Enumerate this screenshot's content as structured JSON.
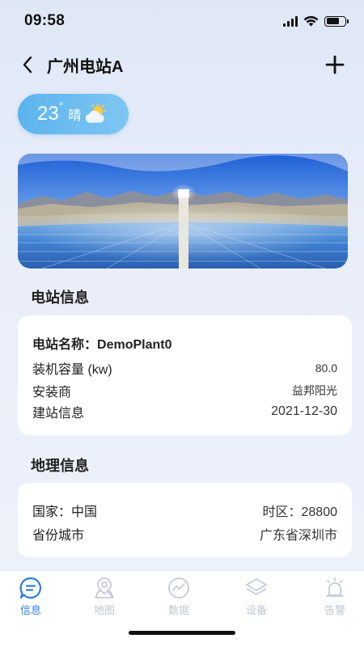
{
  "status_bar": {
    "time": "09:58"
  },
  "nav": {
    "title": "广州电站A"
  },
  "weather": {
    "temperature": "23",
    "degree": "°",
    "condition": "晴",
    "icon": "partly-sunny-icon"
  },
  "station_section": {
    "title": "电站信息",
    "name_label": "电站名称：",
    "name_value": "DemoPlant0",
    "capacity_label": "装机容量 (kw)",
    "capacity_value": "80.0",
    "installer_label": "安装商",
    "installer_value": "益邦阳光",
    "built_label": "建站信息",
    "built_value": "2021-12-30"
  },
  "geo_section": {
    "title": "地理信息",
    "country_label": "国家：",
    "country_value": "中国",
    "timezone_label": "时区：",
    "timezone_value": "28800",
    "province_label": "省份城市",
    "province_value": "广东省深圳市"
  },
  "tabs": [
    {
      "label": "信息",
      "icon": "info-chat-icon",
      "active": true
    },
    {
      "label": "地图",
      "icon": "map-pin-icon",
      "active": false
    },
    {
      "label": "数据",
      "icon": "data-trend-icon",
      "active": false
    },
    {
      "label": "设备",
      "icon": "layers-icon",
      "active": false
    },
    {
      "label": "告警",
      "icon": "alarm-icon",
      "active": false
    }
  ],
  "colors": {
    "accent": "#2d7fe0",
    "inactive": "#bfc5d2",
    "weather_pill": "#6bbcf0"
  }
}
